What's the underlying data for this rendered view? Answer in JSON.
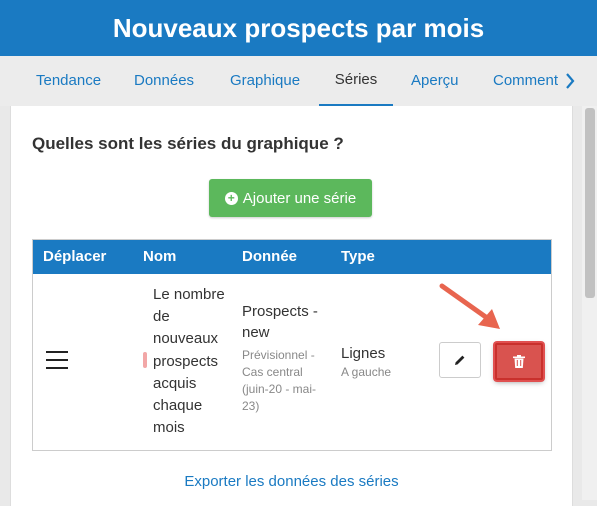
{
  "header": {
    "title": "Nouveaux prospects par mois"
  },
  "tabs": [
    {
      "label": "Tendance",
      "active": false
    },
    {
      "label": "Données",
      "active": false
    },
    {
      "label": "Graphique",
      "active": false
    },
    {
      "label": "Séries",
      "active": true
    },
    {
      "label": "Aperçu",
      "active": false
    },
    {
      "label": "Comment",
      "active": false
    }
  ],
  "panel": {
    "question": "Quelles sont les séries du graphique ?",
    "add_button": "Ajouter une série",
    "table": {
      "headers": {
        "move": "Déplacer",
        "name": "Nom",
        "data": "Donnée",
        "type": "Type"
      },
      "rows": [
        {
          "name": "Le nombre de nouveaux prospects acquis chaque mois",
          "data_main": "Prospects - new",
          "data_sub": "Prévisionnel - Cas central (juin-20 - mai-23)",
          "type_main": "Lignes",
          "type_sub": "A gauche"
        }
      ]
    },
    "export_link": "Exporter les données des séries"
  },
  "colors": {
    "brand_blue": "#1a7ac2",
    "success_green": "#5cb85c",
    "danger_red": "#d9534f",
    "annotation_arrow": "#e8654f",
    "series_marker": "#f2a7a7"
  },
  "icons": {
    "add": "plus-circle-icon",
    "drag": "hamburger-icon",
    "edit": "pencil-icon",
    "delete": "trash-icon",
    "next_tabs": "chevron-right-icon"
  }
}
